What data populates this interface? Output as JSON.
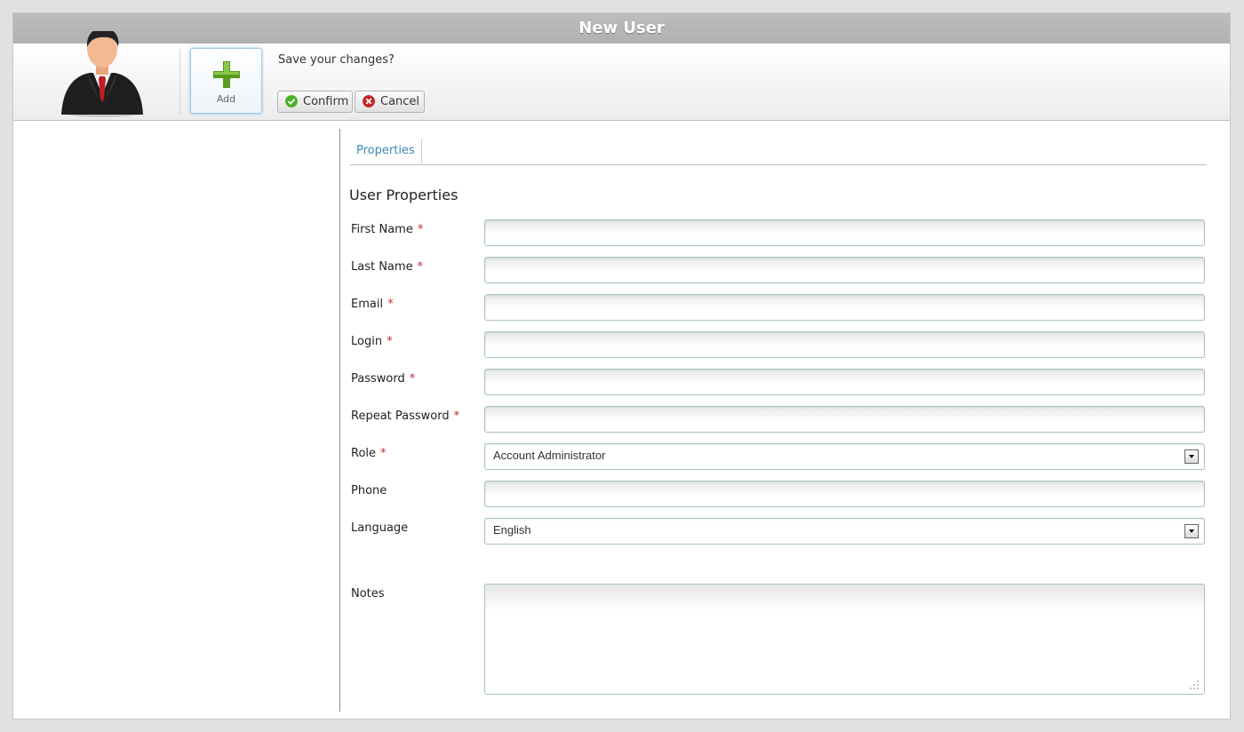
{
  "window": {
    "title": "New User"
  },
  "toolbar": {
    "add_label": "Add",
    "prompt": "Save your changes?",
    "confirm_label": "Confirm",
    "cancel_label": "Cancel"
  },
  "tabs": [
    {
      "label": "Properties"
    }
  ],
  "form": {
    "section_title": "User Properties",
    "required_mark": "*",
    "fields": {
      "first_name": {
        "label": "First Name",
        "required": true,
        "value": ""
      },
      "last_name": {
        "label": "Last Name",
        "required": true,
        "value": ""
      },
      "email": {
        "label": "Email",
        "required": true,
        "value": ""
      },
      "login": {
        "label": "Login",
        "required": true,
        "value": ""
      },
      "password": {
        "label": "Password",
        "required": true,
        "value": ""
      },
      "repeat_password": {
        "label": "Repeat Password",
        "required": true,
        "value": ""
      },
      "role": {
        "label": "Role",
        "required": true,
        "value": "Account Administrator"
      },
      "phone": {
        "label": "Phone",
        "required": false,
        "value": ""
      },
      "language": {
        "label": "Language",
        "required": false,
        "value": "English"
      },
      "notes": {
        "label": "Notes",
        "required": false,
        "value": ""
      }
    }
  },
  "colors": {
    "titlebar": "#b5b5b5",
    "tab_text": "#3d8bb0",
    "required": "#c62a2a",
    "confirm_icon": "#4caf2a",
    "cancel_icon": "#c0282a",
    "add_icon": "#5a9a1e"
  },
  "icons": {
    "avatar": "user-avatar-icon",
    "add": "plus-icon",
    "confirm": "checkmark-icon",
    "cancel": "close-icon",
    "dropdown": "chevron-down-icon",
    "resize": "resize-grip-icon"
  }
}
